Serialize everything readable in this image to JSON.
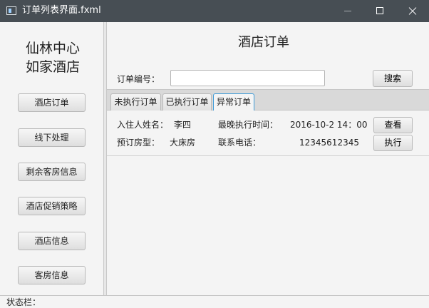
{
  "window": {
    "title": "订单列表界面.fxml",
    "icon": "window-app-icon"
  },
  "sidebar": {
    "hotel_name_line1": "仙林中心",
    "hotel_name_line2": "如家酒店",
    "items": [
      {
        "label": "酒店订单"
      },
      {
        "label": "线下处理"
      },
      {
        "label": "剩余客房信息"
      },
      {
        "label": "酒店促销策略"
      },
      {
        "label": "酒店信息"
      },
      {
        "label": "客房信息"
      }
    ]
  },
  "main": {
    "title": "酒店订单",
    "search": {
      "label": "订单编号：",
      "value": "",
      "placeholder": "",
      "button_label": "搜索"
    },
    "tabs": [
      {
        "label": "未执行订单",
        "active": false
      },
      {
        "label": "已执行订单",
        "active": false
      },
      {
        "label": "异常订单",
        "active": true
      }
    ],
    "order": {
      "guest_label": "入住人姓名：",
      "guest_value": "李四",
      "latest_time_label": "最晚执行时间：",
      "latest_time_value": "2016-10-2 14：00",
      "room_type_label": "预订房型：",
      "room_type_value": "大床房",
      "phone_label": "联系电话：",
      "phone_value": "12345612345",
      "view_button": "查看",
      "execute_button": "执行"
    }
  },
  "statusbar": {
    "label": "状态栏："
  },
  "colors": {
    "titlebar": "#474e54",
    "active_tab_border": "#3c9ad8",
    "background": "#f4f4f4"
  }
}
